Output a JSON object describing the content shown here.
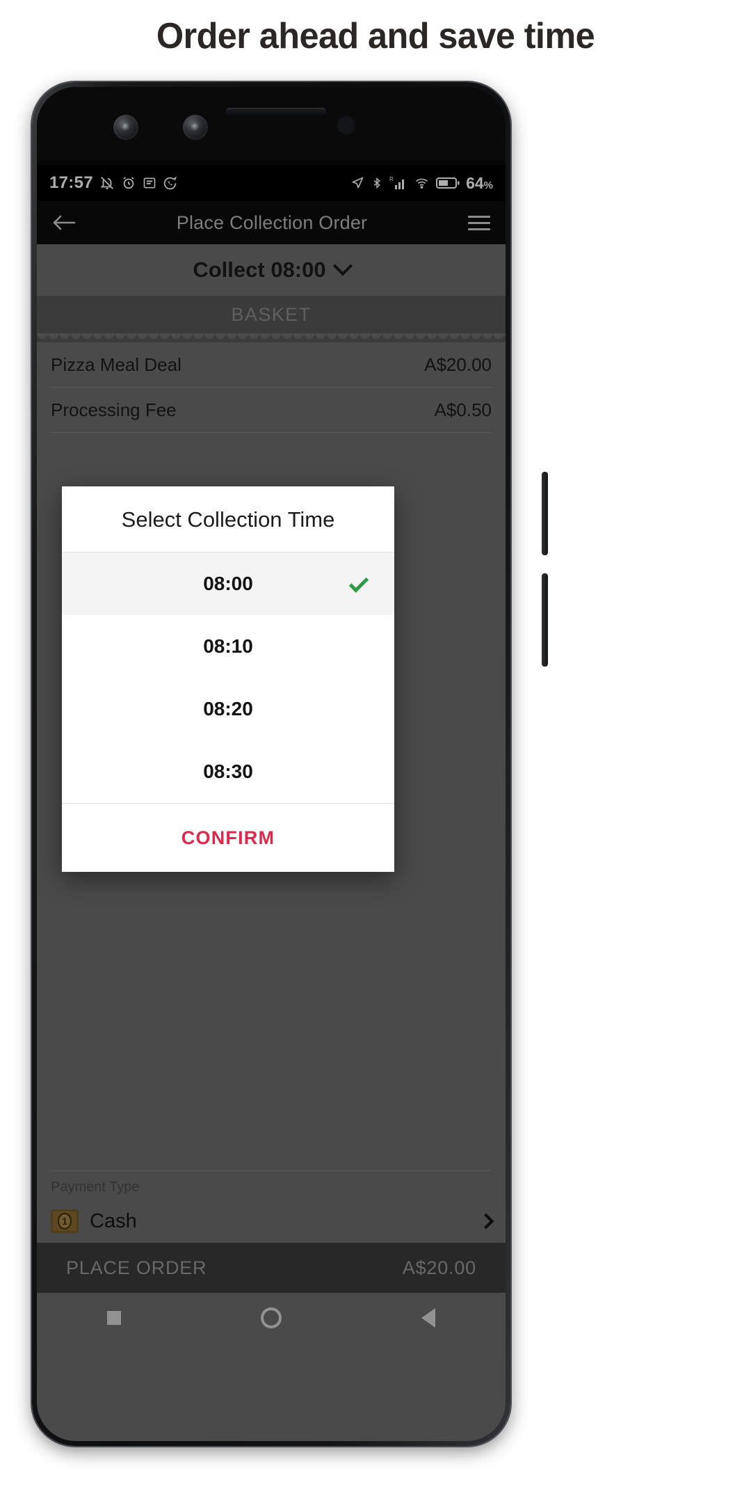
{
  "headline": "Order ahead and save time",
  "status_bar": {
    "time": "17:57",
    "left_icons": [
      "bell-off-icon",
      "alarm-clock-icon",
      "message-icon",
      "whatsapp-icon"
    ],
    "right_icons": [
      "location-arrow-icon",
      "bluetooth-icon",
      "signal-roaming-icon",
      "wifi-icon",
      "battery-icon"
    ],
    "battery_percent": "64",
    "battery_percent_symbol": "%"
  },
  "app_bar": {
    "back_label": "back",
    "title": "Place Collection Order",
    "menu_label": "menu"
  },
  "collect_bar": {
    "label": "Collect 08:00"
  },
  "basket": {
    "header": "BASKET",
    "items": [
      {
        "name": "Pizza Meal Deal",
        "amount": "A$20.00"
      },
      {
        "name": "Processing Fee",
        "amount": "A$0.50"
      }
    ]
  },
  "payment": {
    "label": "Payment Type",
    "value": "Cash",
    "icon": "banknote-icon"
  },
  "place_order": {
    "label": "PLACE ORDER",
    "total": "A$20.00"
  },
  "nav_bar": {
    "recents": "recents",
    "home": "home",
    "back": "back"
  },
  "dialog": {
    "title": "Select Collection Time",
    "options": [
      {
        "time": "08:00",
        "selected": true
      },
      {
        "time": "08:10",
        "selected": false
      },
      {
        "time": "08:20",
        "selected": false
      },
      {
        "time": "08:30",
        "selected": false
      }
    ],
    "confirm_label": "CONFIRM",
    "check_color": "#2e9a45",
    "confirm_color": "#e0284c"
  }
}
